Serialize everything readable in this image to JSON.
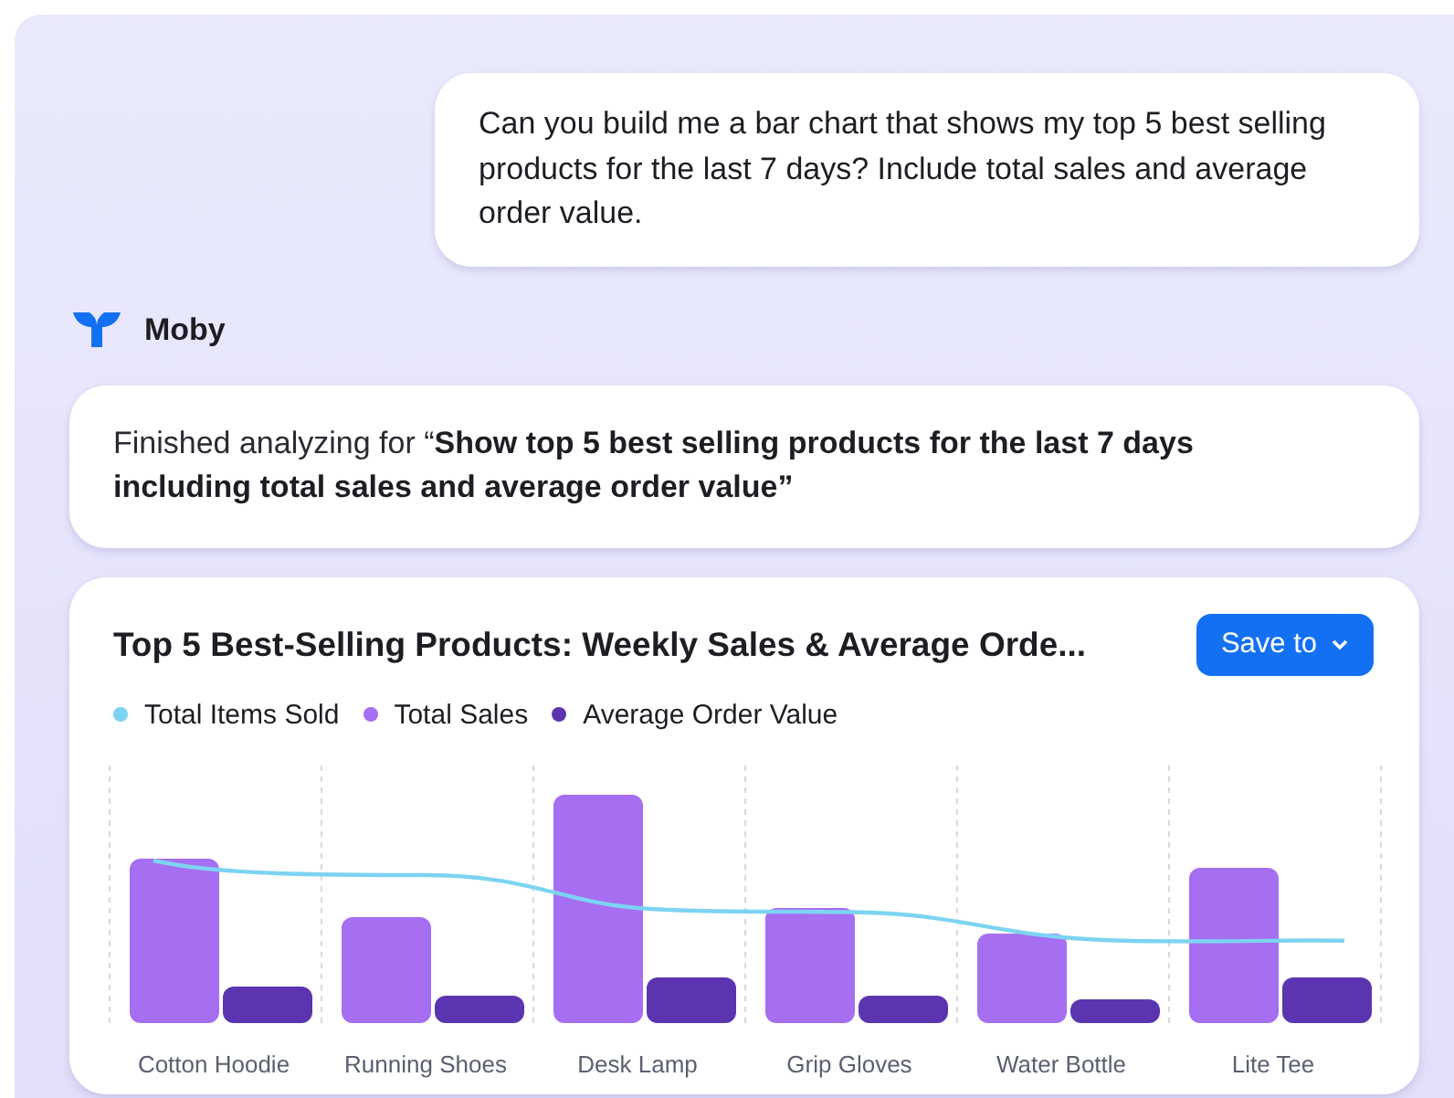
{
  "user_message": "Can you build me a bar chart that shows my top 5 best selling products for the last 7 days? Include total sales and average order value.",
  "assistant": {
    "name": "Moby",
    "status": "Finished analyzing for “**Show top 5 best selling products for the last 7 days including total sales and average order value”**"
  },
  "chart_card": {
    "title": "Top 5 Best-Selling Products: Weekly Sales & Average Orde...",
    "save_button": "Save to",
    "legend": [
      {
        "label": "Total Items Sold",
        "color": "#7dd3f2"
      },
      {
        "label": "Total Sales",
        "color": "#a66ef0"
      },
      {
        "label": "Average Order Value",
        "color": "#5b35b0"
      }
    ],
    "x_labels": [
      "Cotton Hoodie",
      "Running Shoes",
      "Desk Lamp",
      "Grip Gloves",
      "Water Bottle",
      "Lite Tee"
    ]
  }
}
